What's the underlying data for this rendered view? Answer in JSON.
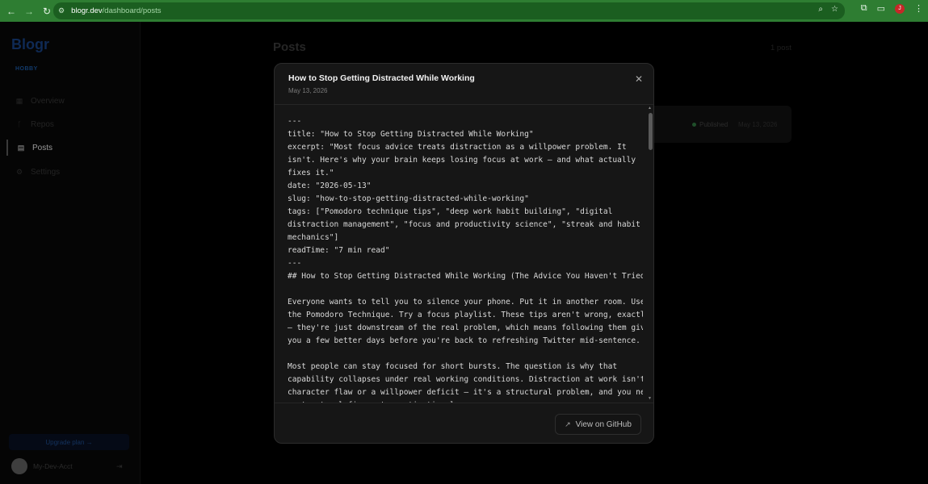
{
  "browser": {
    "back_icon": "back-arrow-icon",
    "forward_icon": "forward-arrow-icon",
    "reload_icon": "reload-icon",
    "url_host": "blogr.dev",
    "url_path": "/dashboard/posts",
    "profile_initial": "J"
  },
  "sidebar": {
    "logo": "Blogr",
    "plan": "HOBBY",
    "items": [
      {
        "label": "Overview",
        "icon": "grid-icon"
      },
      {
        "label": "Repos",
        "icon": "branch-icon"
      },
      {
        "label": "Posts",
        "icon": "document-icon"
      },
      {
        "label": "Settings",
        "icon": "gear-icon"
      }
    ],
    "upgrade_label": "Upgrade plan →",
    "account_name": "My-Dev-Acct"
  },
  "main": {
    "title": "Posts",
    "count": "1 post",
    "row": {
      "status": "Published",
      "date": "May 13, 2026"
    }
  },
  "modal": {
    "title": "How to Stop Getting Distracted While Working",
    "date": "May 13, 2026",
    "content": "---\ntitle: \"How to Stop Getting Distracted While Working\"\nexcerpt: \"Most focus advice treats distraction as a willpower problem. It\nisn't. Here's why your brain keeps losing focus at work — and what actually\nfixes it.\"\ndate: \"2026-05-13\"\nslug: \"how-to-stop-getting-distracted-while-working\"\ntags: [\"Pomodoro technique tips\", \"deep work habit building\", \"digital\ndistraction management\", \"focus and productivity science\", \"streak and habit\nmechanics\"]\nreadTime: \"7 min read\"\n---\n## How to Stop Getting Distracted While Working (The Advice You Haven't Tried)\n\nEveryone wants to tell you to silence your phone. Put it in another room. Use\nthe Pomodoro Technique. Try a focus playlist. These tips aren't wrong, exactly\n— they're just downstream of the real problem, which means following them gives\nyou a few better days before you're back to refreshing Twitter mid-sentence.\n\nMost people can stay focused for short bursts. The question is why that\ncapability collapses under real working conditions. Distraction at work isn't a\ncharacter flaw or a willpower deficit — it's a structural problem, and you need\na structural fix, not a motivational one.",
    "github_button": "View on GitHub"
  }
}
